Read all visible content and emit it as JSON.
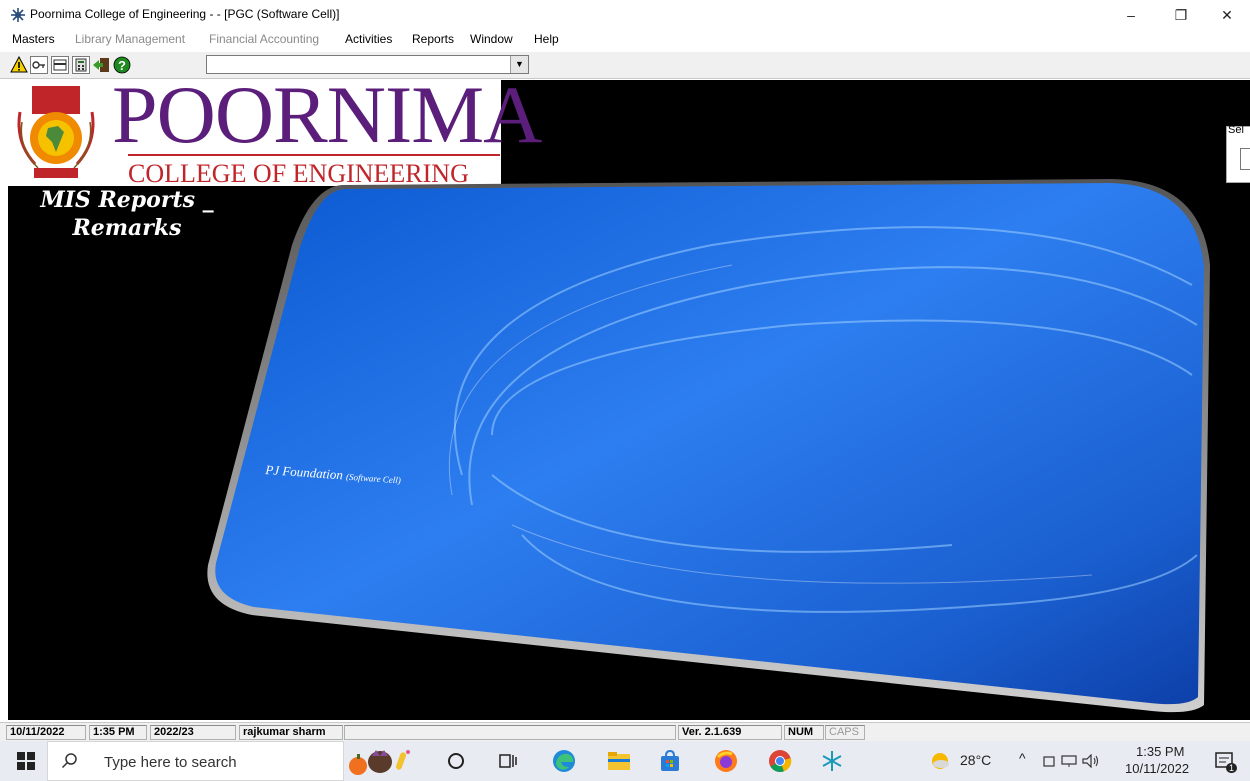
{
  "window": {
    "title": "Poornima College of Engineering -  - [PGC (Software Cell)]",
    "controls": {
      "minimize": "–",
      "maximize": "❐",
      "close": "✕"
    }
  },
  "menu": [
    {
      "label": "Masters",
      "enabled": true
    },
    {
      "label": "Library Management",
      "enabled": false
    },
    {
      "label": "Financial Accounting",
      "enabled": false
    },
    {
      "label": "Activities",
      "enabled": true
    },
    {
      "label": "Reports",
      "enabled": true
    },
    {
      "label": "Window",
      "enabled": true
    },
    {
      "label": "Help",
      "enabled": true
    }
  ],
  "toolbar": {
    "icons": [
      "warning-icon",
      "key-icon",
      "card-icon",
      "calculator-icon",
      "exit-door-icon",
      "help-icon"
    ],
    "combo_value": ""
  },
  "logo": {
    "title": "POORNIMA",
    "subtitle": "COLLEGE OF ENGINEERING"
  },
  "main": {
    "mis_line1": "MIS Reports _",
    "mis_line2": "Remarks",
    "pj_main": "PJ Foundation",
    "pj_sub": "(Software Cell)",
    "select_label": "Sel"
  },
  "status": {
    "date": "10/11/2022",
    "time": "1:35 PM",
    "session": "2022/23",
    "user": "rajkumar sharm",
    "empty": "",
    "version": "Ver. 2.1.639",
    "num": "NUM",
    "caps": "CAPS"
  },
  "taskbar": {
    "search_placeholder": "Type here to search",
    "weather": "28°C",
    "clock_time": "1:35 PM",
    "clock_date": "10/11/2022",
    "notification_count": "1"
  },
  "colors": {
    "brand_purple": "#5b1e7a",
    "brand_red": "#c0252a",
    "splash_blue": "#1a63d8"
  }
}
